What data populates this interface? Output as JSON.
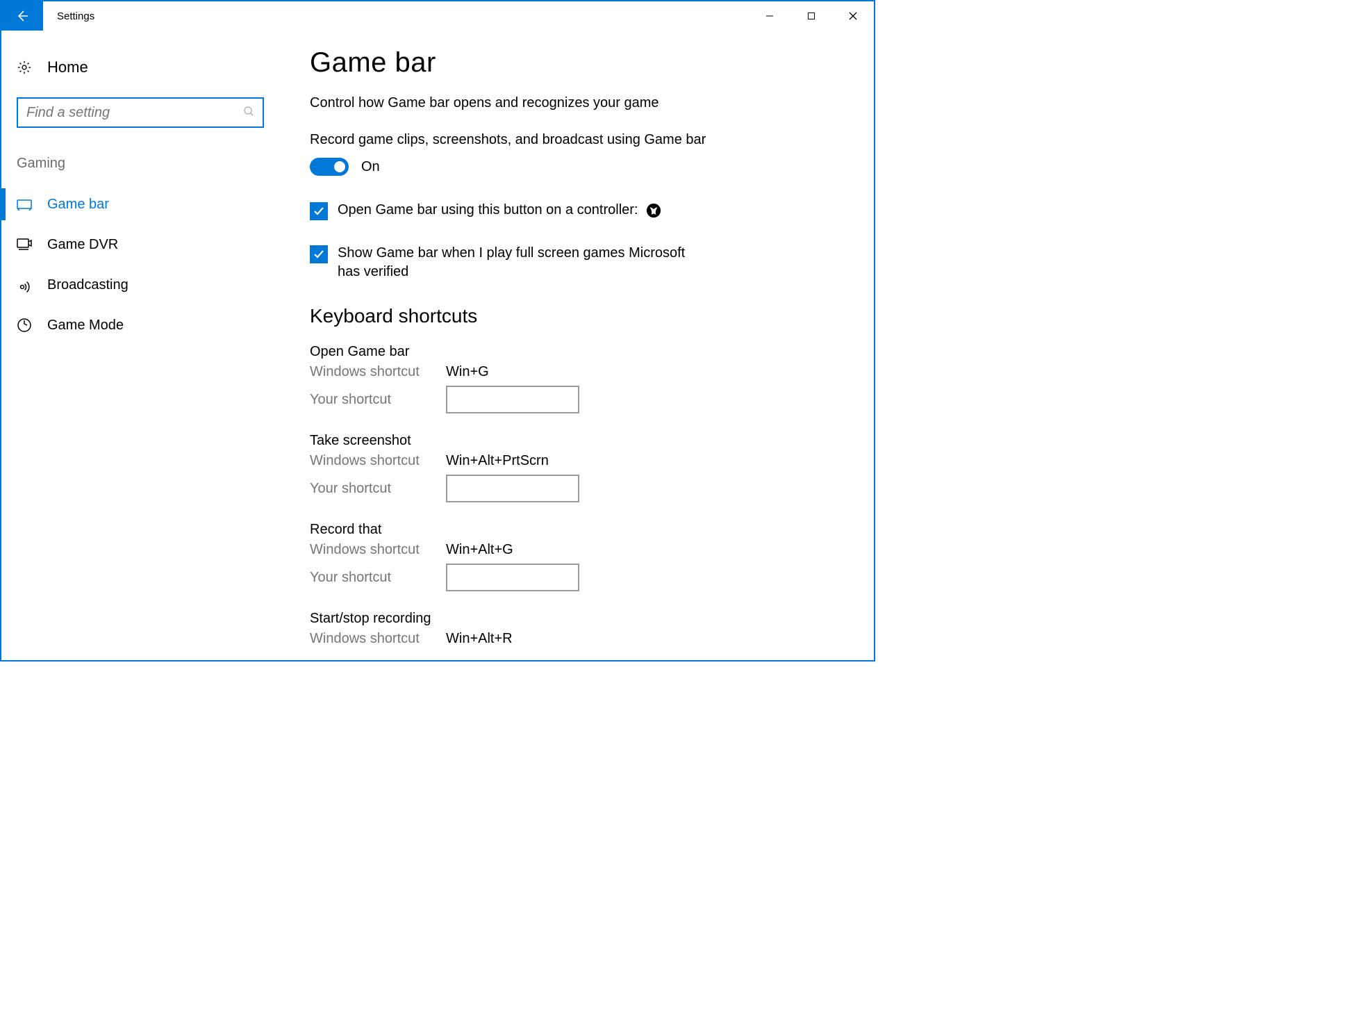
{
  "window": {
    "title": "Settings"
  },
  "sidebar": {
    "home_label": "Home",
    "search_placeholder": "Find a setting",
    "category_label": "Gaming",
    "items": [
      {
        "label": "Game bar",
        "active": true
      },
      {
        "label": "Game DVR",
        "active": false
      },
      {
        "label": "Broadcasting",
        "active": false
      },
      {
        "label": "Game Mode",
        "active": false
      }
    ]
  },
  "main": {
    "title": "Game bar",
    "description": "Control how Game bar opens and recognizes your game",
    "record_label": "Record game clips, screenshots, and broadcast using Game bar",
    "toggle_status": "On",
    "check_controller": "Open Game bar using this button on a controller:",
    "check_fullscreen": "Show Game bar when I play full screen games Microsoft has verified",
    "shortcuts_heading": "Keyboard shortcuts",
    "win_shortcut_label": "Windows shortcut",
    "your_shortcut_label": "Your shortcut",
    "shortcuts": [
      {
        "name": "Open Game bar",
        "win": "Win+G"
      },
      {
        "name": "Take screenshot",
        "win": "Win+Alt+PrtScrn"
      },
      {
        "name": "Record that",
        "win": "Win+Alt+G"
      },
      {
        "name": "Start/stop recording",
        "win": "Win+Alt+R"
      }
    ]
  }
}
